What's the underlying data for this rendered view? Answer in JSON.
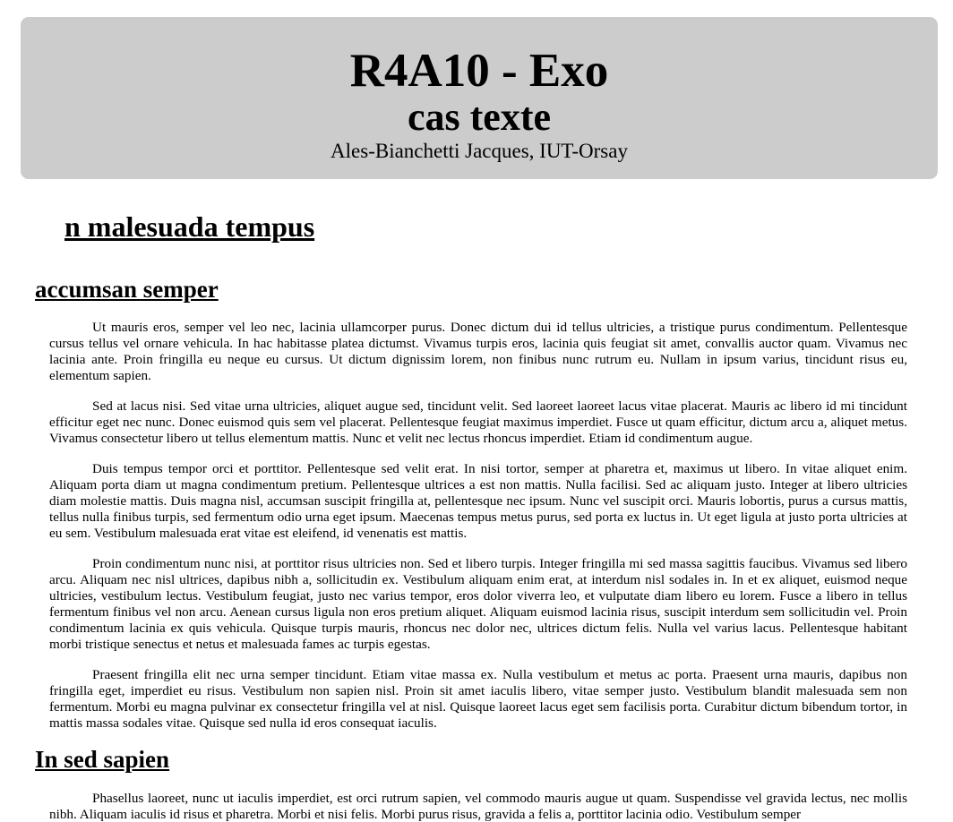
{
  "header": {
    "title": "R4A10 - Exo",
    "subtitle": "cas texte",
    "author": "Ales-Bianchetti Jacques, IUT-Orsay"
  },
  "doc": {
    "section_title": "n malesuada tempus",
    "subsection1": {
      "title": "accumsan semper",
      "paragraphs": [
        "Ut mauris eros, semper vel leo nec, lacinia ullamcorper purus. Donec dictum dui id tellus ultricies, a tristique purus condimentum. Pellentesque cursus tellus vel ornare vehicula. In hac habitasse platea dictumst. Vivamus turpis eros, lacinia quis feugiat sit amet, convallis auctor quam. Vivamus nec lacinia ante. Proin fringilla eu neque eu cursus. Ut dictum dignissim lorem, non finibus nunc rutrum eu. Nullam in ipsum varius, tincidunt risus eu, elementum sapien.",
        "Sed at lacus nisi. Sed vitae urna ultricies, aliquet augue sed, tincidunt velit. Sed laoreet laoreet lacus vitae placerat. Mauris ac libero id mi tincidunt efficitur eget nec nunc. Donec euismod quis sem vel placerat. Pellentesque feugiat maximus imperdiet. Fusce ut quam efficitur, dictum arcu a, aliquet metus. Vivamus consectetur libero ut tellus elementum mattis. Nunc et velit nec lectus rhoncus imperdiet. Etiam id condimentum augue.",
        "Duis tempus tempor orci et porttitor. Pellentesque sed velit erat. In nisi tortor, semper at pharetra et, maximus ut libero. In vitae aliquet enim. Aliquam porta diam ut magna condimentum pretium. Pellentesque ultrices a est non mattis. Nulla facilisi. Sed ac aliquam justo. Integer at libero ultricies diam molestie mattis. Duis magna nisl, accumsan suscipit fringilla at, pellentesque nec ipsum. Nunc vel suscipit orci. Mauris lobortis, purus a cursus mattis, tellus nulla finibus turpis, sed fermentum odio urna eget ipsum. Maecenas tempus metus purus, sed porta ex luctus in. Ut eget ligula at justo porta ultricies at eu sem. Vestibulum malesuada erat vitae est eleifend, id venenatis est mattis.",
        "Proin condimentum nunc nisi, at porttitor risus ultricies non. Sed et libero turpis. Integer fringilla mi sed massa sagittis faucibus. Vivamus sed libero arcu. Aliquam nec nisl ultrices, dapibus nibh a, sollicitudin ex. Vestibulum aliquam enim erat, at interdum nisl sodales in. In et ex aliquet, euismod neque ultricies, vestibulum lectus. Vestibulum feugiat, justo nec varius tempor, eros dolor viverra leo, et vulputate diam libero eu lorem. Fusce a libero in tellus fermentum finibus vel non arcu. Aenean cursus ligula non eros pretium aliquet. Aliquam euismod lacinia risus, suscipit interdum sem sollicitudin vel. Proin condimentum lacinia ex quis vehicula. Quisque turpis mauris, rhoncus nec dolor nec, ultrices dictum felis. Nulla vel varius lacus. Pellentesque habitant morbi tristique senectus et netus et malesuada fames ac turpis egestas.",
        "Praesent fringilla elit nec urna semper tincidunt. Etiam vitae massa ex. Nulla vestibulum et metus ac porta. Praesent urna mauris, dapibus non fringilla eget, imperdiet eu risus. Vestibulum non sapien nisl. Proin sit amet iaculis libero, vitae semper justo. Vestibulum blandit malesuada sem non fermentum. Morbi eu magna pulvinar ex consectetur fringilla vel at nisl. Quisque laoreet lacus eget sem facilisis porta. Curabitur dictum bibendum tortor, in mattis massa sodales vitae. Quisque sed nulla id eros consequat iaculis."
      ]
    },
    "subsection2": {
      "title": "In sed sapien",
      "paragraphs": [
        "Phasellus laoreet, nunc ut iaculis imperdiet, est orci rutrum sapien, vel commodo mauris augue ut quam. Suspendisse vel gravida lectus, nec mollis nibh. Aliquam iaculis id risus et pharetra. Morbi et nisi felis. Morbi purus risus, gravida a felis a, porttitor lacinia odio. Vestibulum semper"
      ]
    }
  }
}
